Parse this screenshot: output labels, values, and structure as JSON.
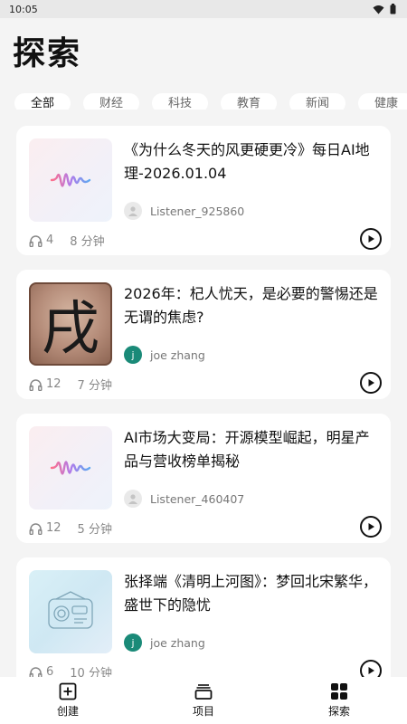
{
  "status": {
    "time": "10:05"
  },
  "page": {
    "title": "探索"
  },
  "tabs": [
    {
      "label": "全部",
      "active": true
    },
    {
      "label": "财经",
      "active": false
    },
    {
      "label": "科技",
      "active": false
    },
    {
      "label": "教育",
      "active": false
    },
    {
      "label": "新闻",
      "active": false
    },
    {
      "label": "健康",
      "active": false
    }
  ],
  "cards": [
    {
      "title": "《为什么冬天的风更硬更冷》每日AI地理-2026.01.04",
      "author": "Listener_925860",
      "avatar": "",
      "listens": "4",
      "duration": "8 分钟",
      "thumbnail": "waveform-icon"
    },
    {
      "title": "2026年：杞人忧天，是必要的警惕还是无谓的焦虑?",
      "author": "joe zhang",
      "avatar": "j",
      "listens": "12",
      "duration": "7 分钟",
      "thumbnail": "calligraphy-image",
      "glyph": "戌"
    },
    {
      "title": "AI市场大变局：开源模型崛起，明星产品与营收榜单揭秘",
      "author": "Listener_460407",
      "avatar": "",
      "listens": "12",
      "duration": "5 分钟",
      "thumbnail": "waveform-icon"
    },
    {
      "title": "张择端《清明上河图》：梦回北宋繁华，盛世下的隐忧",
      "author": "joe zhang",
      "avatar": "j",
      "listens": "6",
      "duration": "10 分钟",
      "thumbnail": "radio-sketch-image"
    }
  ],
  "nav": {
    "create": "创建",
    "projects": "项目",
    "explore": "探索"
  }
}
